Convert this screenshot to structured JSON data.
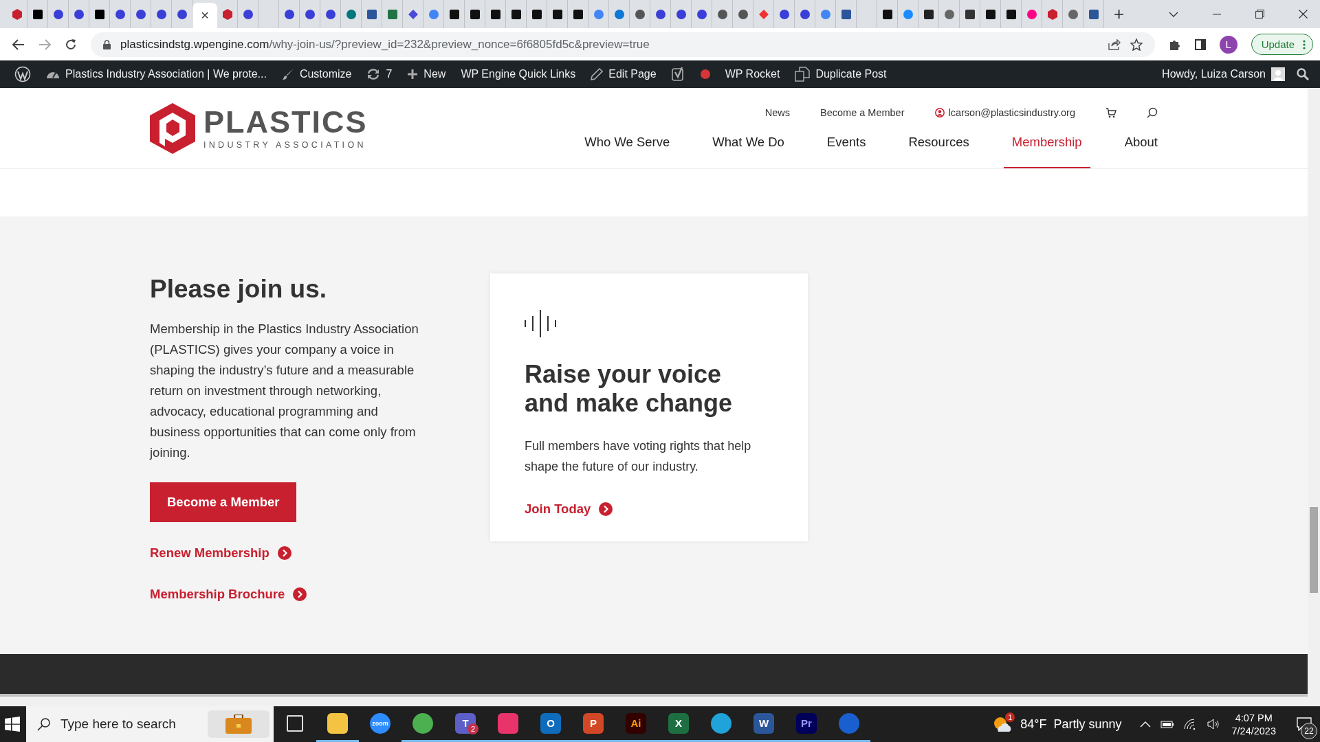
{
  "browser": {
    "tabs": [
      {
        "kind": "plastics",
        "selected": false
      },
      {
        "kind": "c",
        "selected": false
      },
      {
        "kind": "swirl",
        "selected": false
      },
      {
        "kind": "swirl",
        "selected": false
      },
      {
        "kind": "c",
        "selected": false
      },
      {
        "kind": "swirl",
        "selected": false
      },
      {
        "kind": "swirl",
        "selected": false
      },
      {
        "kind": "swirl",
        "selected": false
      },
      {
        "kind": "swirl",
        "selected": false
      },
      {
        "kind": "close",
        "selected": true,
        "close": "×"
      },
      {
        "kind": "plastics",
        "selected": false
      },
      {
        "kind": "swirl",
        "selected": false
      },
      {
        "kind": "blank",
        "selected": false
      },
      {
        "kind": "swirl",
        "selected": false
      },
      {
        "kind": "swirl",
        "selected": false
      },
      {
        "kind": "swirl",
        "selected": false
      },
      {
        "kind": "sharepoint",
        "selected": false
      },
      {
        "kind": "word",
        "selected": false
      },
      {
        "kind": "excel",
        "selected": false
      },
      {
        "kind": "diamond",
        "selected": false
      },
      {
        "kind": "google",
        "selected": false
      },
      {
        "kind": "is",
        "selected": false
      },
      {
        "kind": "is",
        "selected": false
      },
      {
        "kind": "is",
        "selected": false
      },
      {
        "kind": "is",
        "selected": false
      },
      {
        "kind": "is",
        "selected": false
      },
      {
        "kind": "is",
        "selected": false
      },
      {
        "kind": "is",
        "selected": false
      },
      {
        "kind": "google",
        "selected": false
      },
      {
        "kind": "onedrive",
        "selected": false
      },
      {
        "kind": "chrome",
        "selected": false
      },
      {
        "kind": "swirl",
        "selected": false
      },
      {
        "kind": "swirl",
        "selected": false
      },
      {
        "kind": "swirl",
        "selected": false
      },
      {
        "kind": "chrome",
        "selected": false
      },
      {
        "kind": "chrome",
        "selected": false
      },
      {
        "kind": "x",
        "selected": false
      },
      {
        "kind": "swirl",
        "selected": false
      },
      {
        "kind": "swirl",
        "selected": false
      },
      {
        "kind": "google",
        "selected": false
      },
      {
        "kind": "word",
        "selected": false
      },
      {
        "kind": "blank",
        "selected": false
      },
      {
        "kind": "f",
        "selected": false
      },
      {
        "kind": "cblue",
        "selected": false
      },
      {
        "kind": "heart",
        "selected": false
      },
      {
        "kind": "globe",
        "selected": false
      },
      {
        "kind": "l",
        "selected": false
      },
      {
        "kind": "is",
        "selected": false
      },
      {
        "kind": "is",
        "selected": false
      },
      {
        "kind": "flickr",
        "selected": false
      },
      {
        "kind": "plastics",
        "selected": false
      },
      {
        "kind": "globe",
        "selected": false
      },
      {
        "kind": "word",
        "selected": false
      }
    ],
    "new_tab": "+",
    "url_host": "plasticsindstg.wpengine.com",
    "url_path": "/why-join-us/?preview_id=232&preview_nonce=6f6805fd5c&preview=true",
    "profile": "L",
    "update": "Update"
  },
  "admin_bar": {
    "items": [
      {
        "kind": "wp"
      },
      {
        "kind": "gauge",
        "label": "Plastics Industry Association | We prote..."
      },
      {
        "kind": "brush",
        "label": "Customize"
      },
      {
        "kind": "sync",
        "label": "7"
      },
      {
        "kind": "plus",
        "label": "New"
      },
      {
        "kind": "text",
        "label": "WP Engine Quick Links"
      },
      {
        "kind": "pencil",
        "label": "Edit Page"
      },
      {
        "kind": "yoast"
      },
      {
        "kind": "dot"
      },
      {
        "kind": "text",
        "label": "WP Rocket"
      },
      {
        "kind": "copy",
        "label": "Duplicate Post"
      }
    ],
    "howdy": "Howdy, Luiza Carson"
  },
  "site_header": {
    "logo_title": "PLASTICS",
    "logo_subtitle": "INDUSTRY ASSOCIATION",
    "utility": [
      "News",
      "Become a Member"
    ],
    "email": "lcarson@plasticsindustry.org",
    "nav": [
      {
        "label": "Who We Serve",
        "selected": false
      },
      {
        "label": "What We Do",
        "selected": false
      },
      {
        "label": "Events",
        "selected": false
      },
      {
        "label": "Resources",
        "selected": false
      },
      {
        "label": "Membership",
        "selected": true
      },
      {
        "label": "About",
        "selected": false
      }
    ]
  },
  "join": {
    "heading": "Please join us.",
    "body": "Membership in the Plastics Industry Association (PLASTICS) gives your company a voice in shaping the industry’s future and a measurable return on investment through networking, advocacy, educational programming and business opportunities that can come only from joining.",
    "button": "Become a Member",
    "links": [
      "Renew Membership",
      "Membership Brochure"
    ]
  },
  "card": {
    "title": "Raise your voice and make change",
    "body": "Full members have voting rights that help shape the future of our industry.",
    "link": "Join Today"
  },
  "taskbar": {
    "search_placeholder": "Type here to search",
    "apps": [
      {
        "kind": "tasks",
        "active": false
      },
      {
        "kind": "folder",
        "active": true
      },
      {
        "kind": "zoom",
        "glyph": "zoom",
        "active": false
      },
      {
        "kind": "chrome",
        "active": true
      },
      {
        "kind": "teams",
        "glyph": "T",
        "active": true
      },
      {
        "kind": "cloud",
        "active": true
      },
      {
        "kind": "outlook",
        "glyph": "O",
        "active": true
      },
      {
        "kind": "ppt",
        "glyph": "P",
        "active": true
      },
      {
        "kind": "ai",
        "glyph": "Ai",
        "active": true
      },
      {
        "kind": "excel",
        "glyph": "X",
        "active": true
      },
      {
        "kind": "edge",
        "active": true
      },
      {
        "kind": "word",
        "glyph": "W",
        "active": true
      },
      {
        "kind": "pr",
        "glyph": "Pr",
        "active": true
      },
      {
        "kind": "onepass",
        "active": true
      }
    ],
    "teams_badge": "2",
    "weather_badge": "1",
    "weather": "84°F  Partly sunny",
    "time": "4:07 PM",
    "date": "7/24/2023",
    "notifications": "22"
  }
}
